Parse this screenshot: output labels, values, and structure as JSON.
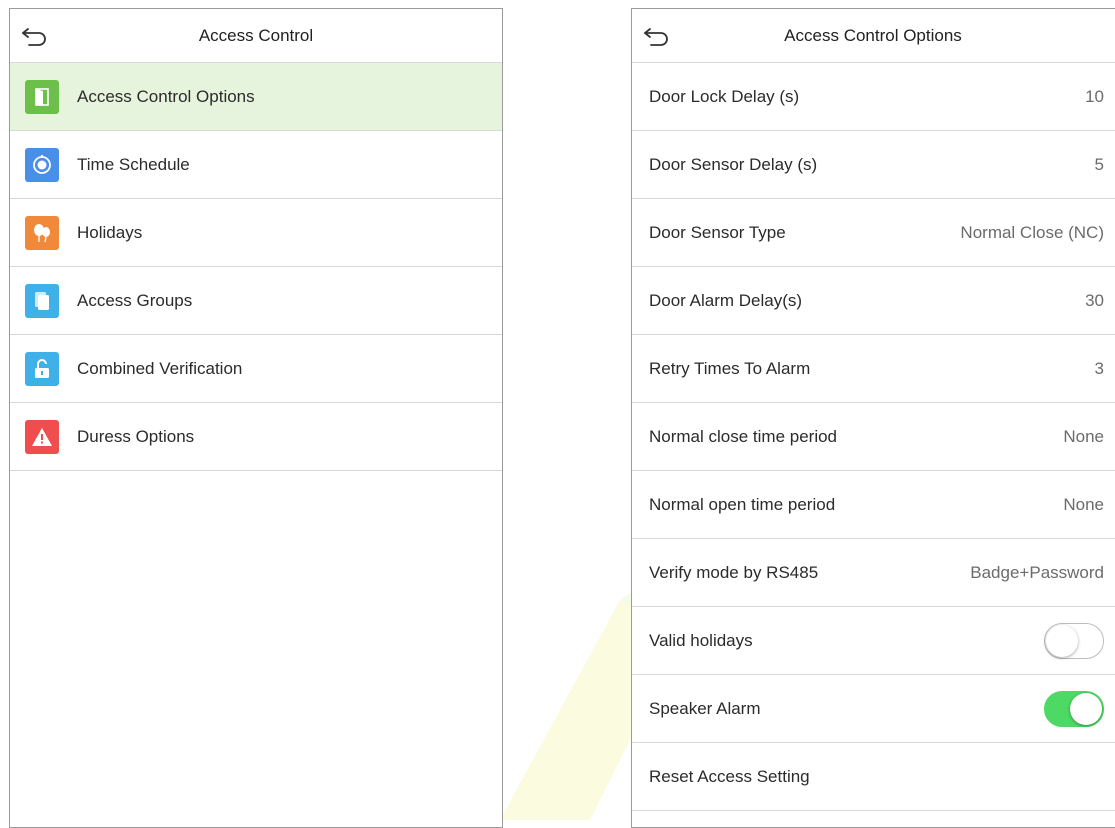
{
  "left_panel": {
    "title": "Access Control",
    "items": [
      {
        "label": "Access Control Options",
        "icon": "door-icon",
        "color": "#6cc04a",
        "selected": true
      },
      {
        "label": "Time Schedule",
        "icon": "clock-icon",
        "color": "#4a8fe7",
        "selected": false
      },
      {
        "label": "Holidays",
        "icon": "balloons-icon",
        "color": "#f08a3a",
        "selected": false
      },
      {
        "label": "Access Groups",
        "icon": "group-icon",
        "color": "#3fb0e8",
        "selected": false
      },
      {
        "label": "Combined Verification",
        "icon": "padlock-icon",
        "color": "#3fb0e8",
        "selected": false
      },
      {
        "label": "Duress Options",
        "icon": "warning-icon",
        "color": "#f04e4e",
        "selected": false
      }
    ]
  },
  "right_panel": {
    "title": "Access Control Options",
    "rows": [
      {
        "label": "Door Lock Delay (s)",
        "value": "10"
      },
      {
        "label": "Door Sensor Delay (s)",
        "value": "5"
      },
      {
        "label": "Door Sensor Type",
        "value": "Normal Close (NC)"
      },
      {
        "label": "Door Alarm Delay(s)",
        "value": "30"
      },
      {
        "label": "Retry Times To Alarm",
        "value": "3"
      },
      {
        "label": "Normal close time period",
        "value": "None"
      },
      {
        "label": "Normal open time period",
        "value": "None"
      },
      {
        "label": "Verify mode by RS485",
        "value": "Badge+Password"
      },
      {
        "label": "Valid holidays",
        "toggle": false
      },
      {
        "label": "Speaker Alarm",
        "toggle": true
      },
      {
        "label": "Reset Access Setting"
      }
    ]
  },
  "colors": {
    "selected_row_bg": "#e6f4dd",
    "toggle_on": "#4cd964",
    "divider": "#d9d9d9"
  }
}
